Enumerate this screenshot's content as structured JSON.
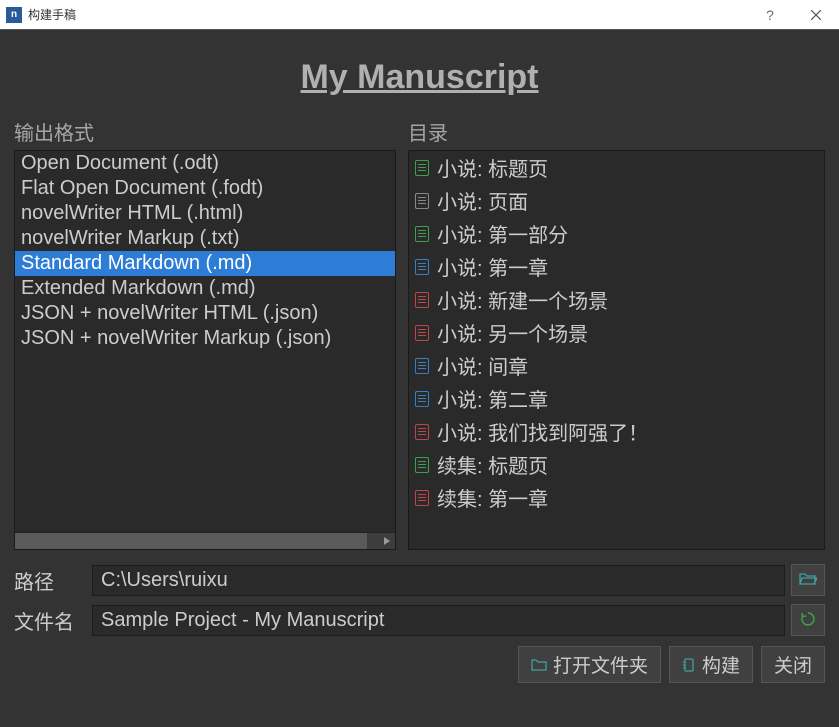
{
  "window": {
    "title": "构建手稿"
  },
  "header": {
    "title": "My Manuscript"
  },
  "labels": {
    "output_format": "输出格式",
    "toc": "目录",
    "path": "路径",
    "filename": "文件名"
  },
  "formats": [
    "Open Document (.odt)",
    "Flat Open Document (.fodt)",
    "novelWriter HTML (.html)",
    "novelWriter Markup (.txt)",
    "Standard Markdown (.md)",
    "Extended Markdown (.md)",
    "JSON + novelWriter HTML (.json)",
    "JSON + novelWriter Markup (.json)"
  ],
  "formats_selected_index": 4,
  "toc_items": [
    {
      "color": "green",
      "label": "小说: 标题页"
    },
    {
      "color": "gray",
      "label": "小说: 页面"
    },
    {
      "color": "green",
      "label": "小说: 第一部分"
    },
    {
      "color": "blue",
      "label": "小说: 第一章"
    },
    {
      "color": "red",
      "label": "小说: 新建一个场景"
    },
    {
      "color": "red",
      "label": "小说: 另一个场景"
    },
    {
      "color": "blue",
      "label": "小说: 间章"
    },
    {
      "color": "blue",
      "label": "小说: 第二章"
    },
    {
      "color": "red",
      "label": "小说: 我们找到阿强了！"
    },
    {
      "color": "green",
      "label": "续集: 标题页"
    },
    {
      "color": "red",
      "label": "续集: 第一章"
    }
  ],
  "inputs": {
    "path": "C:\\Users\\ruixu",
    "filename": "Sample Project - My Manuscript"
  },
  "buttons": {
    "open_folder": "打开文件夹",
    "build": "构建",
    "close": "关闭"
  }
}
